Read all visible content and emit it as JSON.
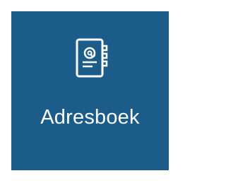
{
  "tile": {
    "label": "Adresboek",
    "icon": "address-book-icon",
    "background_color": "#1c5c8a",
    "text_color": "#ffffff"
  }
}
